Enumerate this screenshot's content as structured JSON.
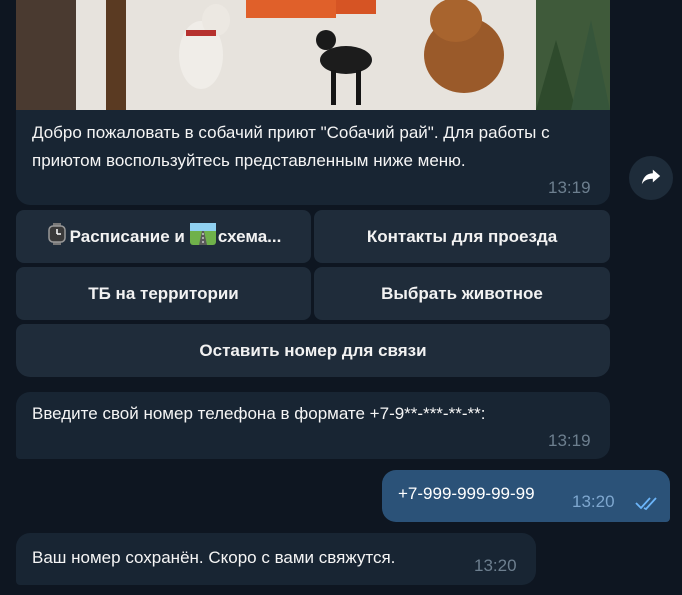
{
  "message1": {
    "caption": "Добро пожаловать в собачий приют \"Собачий рай\". Для работы с приютом воспользуйтесь представленным ниже меню.",
    "time": "13:19"
  },
  "keyboard": {
    "schedule": {
      "label": "Расписание и",
      "label2": "схема...",
      "icon1": "watch-icon",
      "icon2": "road-map-icon"
    },
    "contacts": "Контакты для проезда",
    "safety": "ТБ на территории",
    "choose_animal": "Выбрать животное",
    "leave_number": "Оставить номер для связи"
  },
  "message2": {
    "text": "Введите свой номер телефона в формате +7-9**-***-**-**:",
    "time": "13:19"
  },
  "message_out": {
    "text": "+7-999-999-99-99",
    "time": "13:20",
    "status": "read-double-check"
  },
  "message3": {
    "text": "Ваш номер сохранён. Скоро с вами свяжутся.",
    "time": "13:20"
  },
  "colors": {
    "background": "#0e1621",
    "incoming_bubble": "#182533",
    "outgoing_bubble": "#2b5278",
    "keyboard_button": "#1f2c3a",
    "timestamp": "#6d7f8f",
    "read_check": "#6cb5f9"
  }
}
